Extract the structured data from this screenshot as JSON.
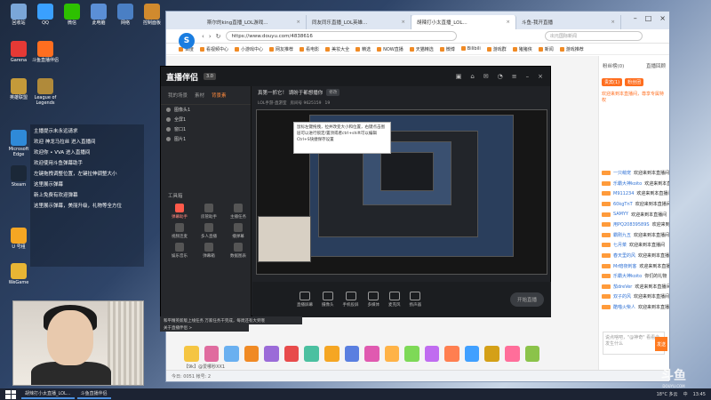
{
  "desktop_icons": [
    {
      "label": "回收站",
      "color": "#7aa6d8"
    },
    {
      "label": "QQ",
      "color": "#3aa0ff"
    },
    {
      "label": "微信",
      "color": "#2dc100"
    },
    {
      "label": "此电脑",
      "color": "#5b8fd6"
    },
    {
      "label": "网络",
      "color": "#4a7fc4"
    },
    {
      "label": "控制面板",
      "color": "#d08a2e"
    },
    {
      "label": "Garena",
      "color": "#e53935"
    },
    {
      "label": "斗鱼直播伴侣",
      "color": "#ff6e1f"
    },
    {
      "label": "英雄联盟",
      "color": "#c49a3a"
    },
    {
      "label": "League of Legends",
      "color": "#b08a3a"
    },
    {
      "label": "Microsoft Edge",
      "color": "#2f8ad8"
    },
    {
      "label": "Steam",
      "color": "#1b2838"
    },
    {
      "label": "U 号租",
      "color": "#f5a623"
    },
    {
      "label": "WeGame",
      "color": "#e8b534"
    }
  ],
  "chat_overlay": [
    "主播提示未永远请求",
    "欢迎 神龙马拉丝 进入直播间",
    "欢迎你 • VVA 进入直播间",
    "欢迎使用斗鱼弹幕助手",
    "左键拖拽调整位置，左键拉伸调整大小",
    "这里展示弹幕",
    "新上免费有欢迎弹幕",
    "这里展示弹幕，美丽升级，礼物等全方位"
  ],
  "browser": {
    "tabs": [
      {
        "label": "斯尔的king直播_LOL游戏..."
      },
      {
        "label": "同友同乐直播_LOL英雄..."
      },
      {
        "label": "胡辣打小太直播_LOL..."
      },
      {
        "label": "斗鱼-我开直播"
      }
    ],
    "url": "https://www.douyu.com/4838616",
    "search_placeholder": "出元国际新闻",
    "bookmarks": [
      "百度",
      "看视频中心",
      "小游戏中心",
      "网友推荐",
      "看电影",
      "美妆大全",
      "精选",
      "NOW直播",
      "天猫精选",
      "微博",
      "Bilibili",
      "游戏群",
      "猪猪侠",
      "新闻",
      "游戏推荐"
    ],
    "status_text": "今日: 0051    帐号: 2",
    "gifts_bar": "【9k】@爱哪秒XX1",
    "right_panel": {
      "tab_label": "直播回顾",
      "rank_title": "粉丝榜(0)",
      "rank_btn": "贵宾(1)",
      "rank_btn2": "粉丝团",
      "notice": "欢迎来到本直播间，尊享专属特权",
      "chat": [
        {
          "name": "一只萌宠",
          "msg": "欢迎来到本直播间"
        },
        {
          "name": "乐霸大神koito",
          "msg": "欢迎来到本直播间"
        },
        {
          "name": "M911234",
          "msg": "欢迎来到本直播间"
        },
        {
          "name": "60kgTnT",
          "msg": "欢迎来到本直播间"
        },
        {
          "name": "SAMYY",
          "msg": "欢迎来到本直播间"
        },
        {
          "name": "用PQ20839589S",
          "msg": "欢迎来到本直播间"
        },
        {
          "name": "霸刚九五",
          "msg": "欢迎来到本直播间"
        },
        {
          "name": "七月菜",
          "msg": "欢迎来到本直播间"
        },
        {
          "name": "春天里的风",
          "msg": "欢迎来到本直播间"
        },
        {
          "name": "Mr暗夜刺客",
          "msg": "欢迎来到本直播间"
        },
        {
          "name": "乐霸大神koito",
          "msg": "你们的礼物"
        },
        {
          "name": "茄dreVer",
          "msg": "欢迎来到本直播间"
        },
        {
          "name": "双子的风",
          "msg": "欢迎来到本直播间"
        },
        {
          "name": "酷喵火柴人",
          "msg": "欢迎来到本直播间"
        }
      ],
      "input_placeholder": "说点啥吧，\"@神奇\" 看看会发生什么",
      "send_label": "发送"
    }
  },
  "obs": {
    "app_name": "直播伴侣",
    "version": "3.0",
    "tabs": [
      "我的场景",
      "素材",
      "背景素"
    ],
    "scenes": [
      "图像头1",
      "全屏1",
      "窗口1",
      "图片1"
    ],
    "tools_title": "工具箱",
    "tools": [
      {
        "label": "弹幕助手",
        "hot": true
      },
      {
        "label": "房管助手",
        "hot": false
      },
      {
        "label": "主播任务",
        "hot": false
      },
      {
        "label": "视频连麦",
        "hot": false
      },
      {
        "label": "多人直播",
        "hot": false
      },
      {
        "label": "播弹幕",
        "hot": false
      },
      {
        "label": "娱乐音乐",
        "hot": false
      },
      {
        "label": "弹幕箱",
        "hot": false
      },
      {
        "label": "数据图表",
        "hot": false
      }
    ],
    "room_title": "真第一抓它！ 谪盼于都想播你",
    "room_tag": "修改",
    "sub_tags": [
      "LOL手游-直游室",
      "房间号 9625159",
      "19"
    ],
    "tooltip": "鼠标左键拖拽，拉并改变大小和位置，右键点击图层可以进行锁定/置顶或者ctrl+shift可以编辑\nCtrl+S快捷保存设置",
    "bottom_buttons": [
      "直播屏幕",
      "摄像头",
      "手机投屏",
      "多媒体",
      "麦克风",
      "扬声器"
    ],
    "start_label": "开始直播",
    "msg1": "和平精英新版上线任务 万家任务干完成，每周还有大奖哦",
    "msg2": "关于直播伴侣 >",
    "watermark": "斗鱼",
    "watermark_sub": "DOUYU.COM"
  },
  "taskbar": {
    "items": [
      "胡辣打小太直播_LOL...",
      "斗鱼直播伴侣"
    ],
    "temp": "18°C 多云",
    "lang": "中",
    "time": "13:45"
  }
}
